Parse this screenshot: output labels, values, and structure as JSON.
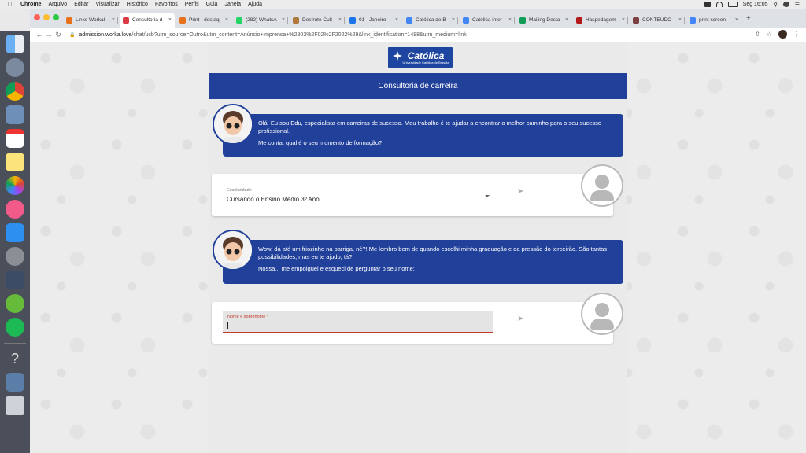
{
  "menubar": {
    "app": "Chrome",
    "items": [
      "Arquivo",
      "Editar",
      "Visualizar",
      "Histórico",
      "Favoritos",
      "Perfis",
      "Guia",
      "Janela",
      "Ajuda"
    ],
    "clock": "Seg 16:05"
  },
  "tabs": [
    {
      "label": "Links Workal",
      "color": "#e8711c"
    },
    {
      "label": "Consultoria d",
      "color": "#d93b44",
      "active": true
    },
    {
      "label": "Print - destaq",
      "color": "#e8711c"
    },
    {
      "label": "(282) WhatsA",
      "color": "#25d366"
    },
    {
      "label": "Desfrute Cult",
      "color": "#b07a3c"
    },
    {
      "label": "01 - Janeiro",
      "color": "#1a73e8"
    },
    {
      "label": "Católica de B",
      "color": "#4285f4"
    },
    {
      "label": "Católica inter",
      "color": "#4285f4"
    },
    {
      "label": "Mailing Desta",
      "color": "#0f9d58"
    },
    {
      "label": "Hospedagem",
      "color": "#b31b1b"
    },
    {
      "label": "CONTEÚDO",
      "color": "#7b3f3f"
    },
    {
      "label": "print screen",
      "color": "#4285f4"
    }
  ],
  "address": {
    "host": "admission.worka.love",
    "path": "/chat/ucb?utm_source=Outro&utm_content=Anúncio+imprensa+%2803%2F02%2F2022%29&link_identification=1488&utm_medium=link"
  },
  "logo": {
    "title": "Católica",
    "subtitle": "Universidade Católica de Brasília"
  },
  "header": {
    "title": "Consultoria de carreira"
  },
  "chat": {
    "bot_message_1": [
      "Olá! Eu sou Edu, especialista em carreiras de sucesso. Meu trabalho é te ajudar a encontrar o melhor caminho para o seu sucesso profissional.",
      "Me conta, qual é o seu momento de formação?"
    ],
    "select": {
      "label": "Escolaridade",
      "value": "Cursando o Ensino Médio 3º Ano"
    },
    "bot_message_2": [
      "Wow, dá até um friozinho na barriga, né?! Me lembro bem de quando escolhi minha graduação e da pressão do terceirão. São tantas possibilidades, mas eu te ajudo, tá?!",
      "Nossa... me empolguei e esqueci de perguntar o seu nome:"
    ],
    "name_input": {
      "label": "Nome e sobrenome *",
      "value": ""
    }
  },
  "colors": {
    "brand_blue": "#21409a",
    "error_red": "#c0392b"
  }
}
